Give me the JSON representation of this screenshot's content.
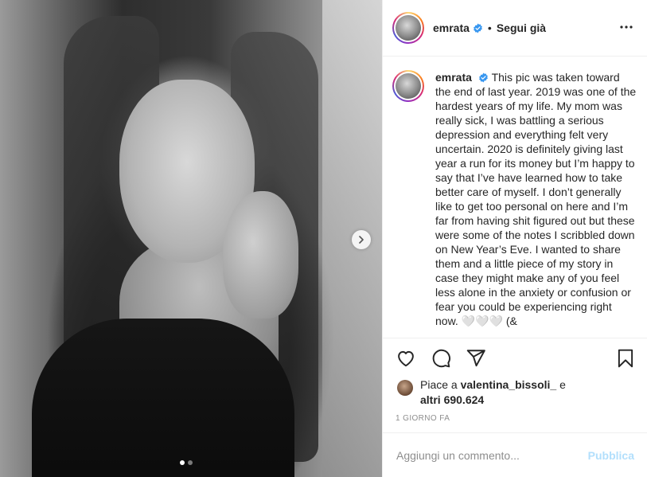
{
  "post": {
    "username": "emrata",
    "verified": true,
    "follow_status": "Segui già",
    "bullet": "•",
    "caption": "This pic was taken toward the end of last year. 2019 was one of the hardest years of my life. My mom was really sick, I was battling a serious depression and everything felt very uncertain. 2020 is definitely giving last year a run for its money but I’m happy to say that I’ve have learned how to take better care of myself. I don’t generally like to get too personal on here and I’m far from having shit figured out but these were some of the notes I scribbled down on New Year’s Eve. I wanted to share them and a little piece of my story in case they might make any of you feel less alone in the anxiety or confusion or fear you could be experiencing right now. 🤍🤍🤍 (&",
    "carousel": {
      "count": 2,
      "active_index": 1
    }
  },
  "likes": {
    "prefix": "Piace a ",
    "liker": "valentina_bissoli_",
    "conjunction": " e",
    "others": "altri 690.624"
  },
  "timestamp": "1 giorno fa",
  "comment_box": {
    "placeholder": "Aggiungi un commento...",
    "publish_label": "Pubblica"
  },
  "icons": {
    "verified": "verified-badge-icon",
    "more": "more-options-icon",
    "like": "heart-icon",
    "comment": "comment-icon",
    "share": "share-icon",
    "save": "bookmark-icon",
    "next": "chevron-right-icon"
  },
  "colors": {
    "verified_blue": "#3897f0",
    "publish_disabled": "#b2dffc",
    "secondary_text": "#8e8e8e"
  }
}
